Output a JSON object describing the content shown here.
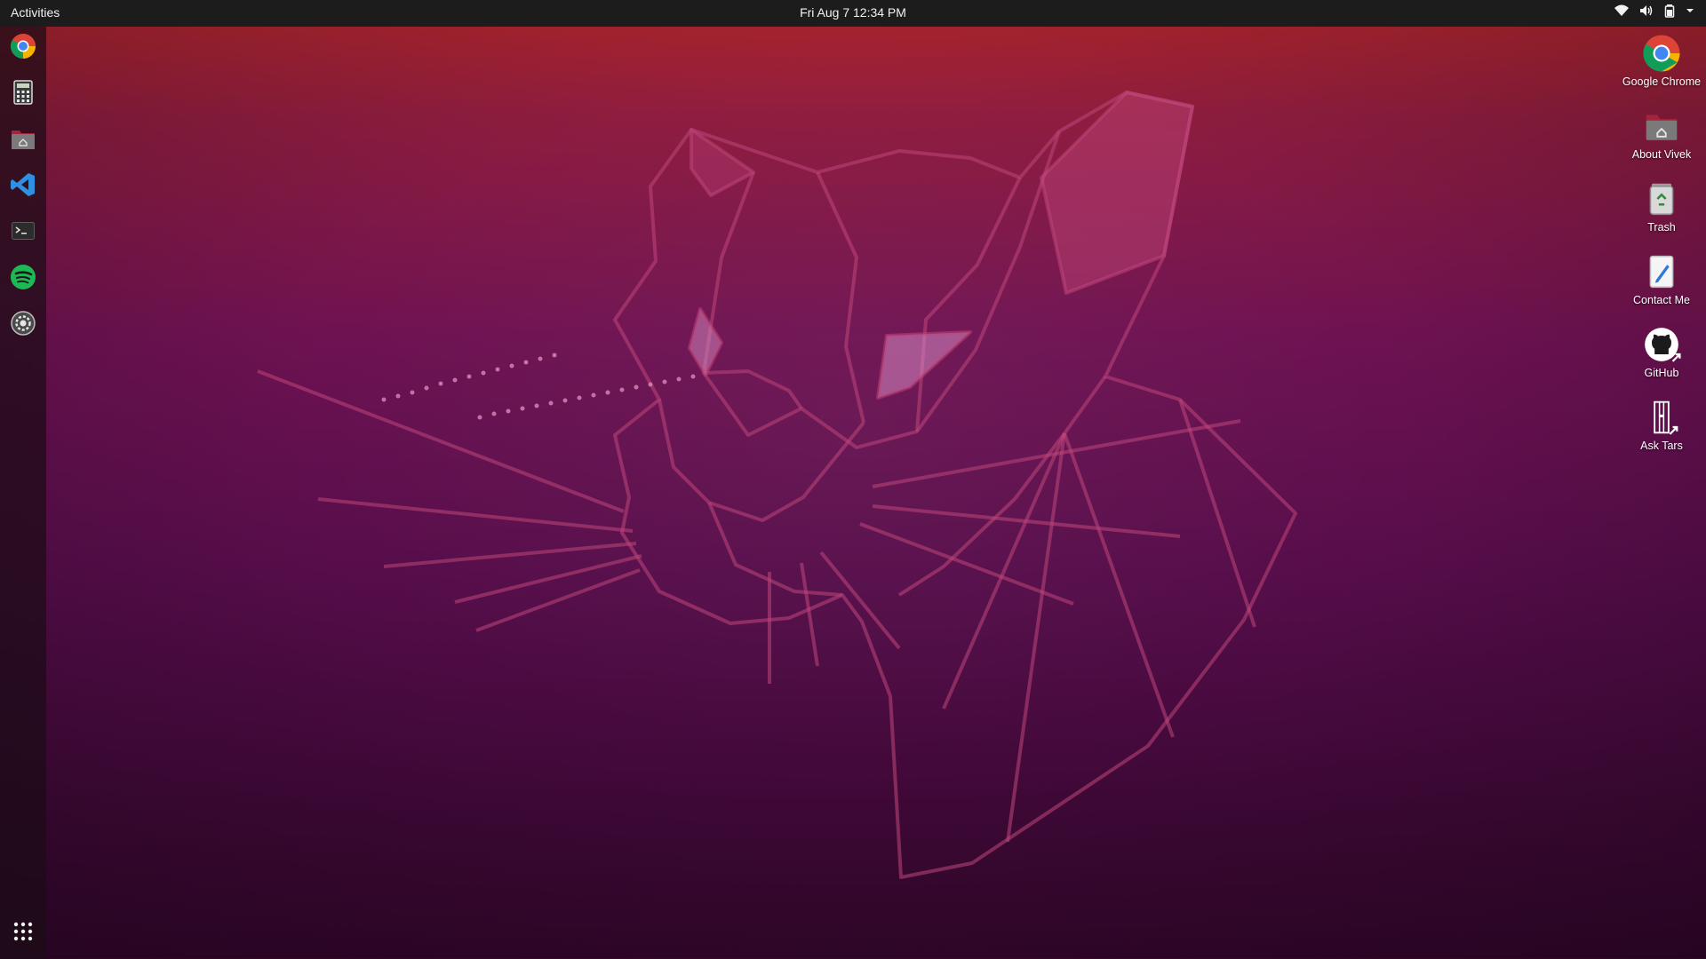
{
  "topbar": {
    "activities": "Activities",
    "clock": "Fri Aug 7 12:34 PM",
    "tray_icons": [
      "wifi-icon",
      "volume-icon",
      "battery-icon",
      "system-menu-arrow-icon"
    ]
  },
  "dock": {
    "items": [
      {
        "name": "Google Chrome",
        "icon": "chrome-icon"
      },
      {
        "name": "Calculator",
        "icon": "calculator-icon"
      },
      {
        "name": "Files",
        "icon": "home-folder-icon"
      },
      {
        "name": "Visual Studio Code",
        "icon": "vscode-icon"
      },
      {
        "name": "Terminal",
        "icon": "terminal-icon"
      },
      {
        "name": "Spotify",
        "icon": "spotify-icon"
      },
      {
        "name": "Settings",
        "icon": "settings-icon"
      }
    ],
    "app_grid_icon": "show-applications-icon"
  },
  "desktop": {
    "icons": [
      {
        "label": "Google Chrome",
        "icon": "chrome-icon"
      },
      {
        "label": "About Vivek",
        "icon": "home-folder-icon"
      },
      {
        "label": "Trash",
        "icon": "trash-icon"
      },
      {
        "label": "Contact Me",
        "icon": "text-editor-icon"
      },
      {
        "label": "GitHub",
        "icon": "github-icon"
      },
      {
        "label": "Ask Tars",
        "icon": "ask-tars-icon"
      }
    ]
  },
  "colors": {
    "topbar": "#1c1c1c",
    "wallpaper_top": "#b3262c",
    "wallpaper_bottom": "#33062c",
    "accent": "#e95420"
  }
}
